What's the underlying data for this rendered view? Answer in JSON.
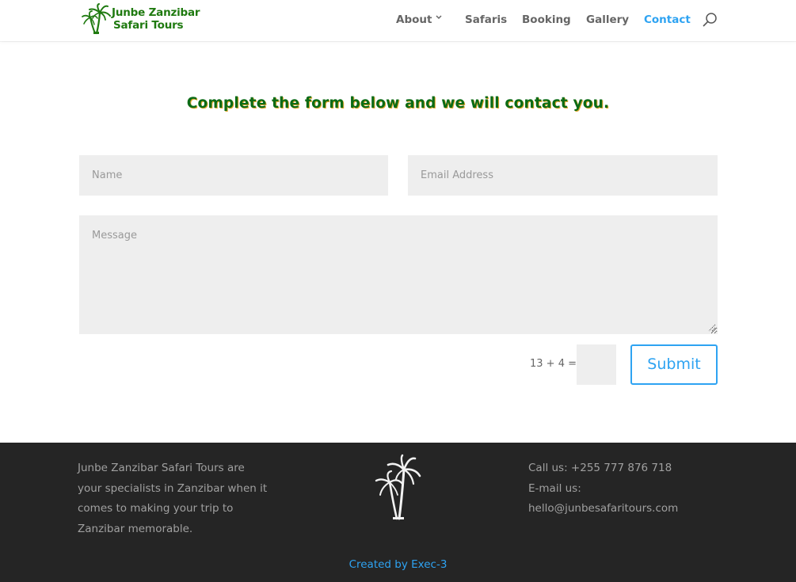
{
  "header": {
    "logo": {
      "line1": "Junbe Zanzibar",
      "line2": "Safari Tours",
      "icon": "palm-trees-icon",
      "color": "#1f7a10"
    },
    "nav": [
      {
        "label": "About",
        "has_dropdown": true,
        "dropdown_icon": "chevron-down-icon",
        "active": false
      },
      {
        "label": "Safaris",
        "active": false
      },
      {
        "label": "Booking",
        "active": false
      },
      {
        "label": "Gallery",
        "active": false
      },
      {
        "label": "Contact",
        "active": true
      }
    ],
    "search_icon": "search-icon",
    "active_color": "#2ea3f2"
  },
  "main": {
    "heading": "Complete the form below and we will contact you.",
    "heading_color": "#0b6b16",
    "form": {
      "name": {
        "placeholder": "Name",
        "value": ""
      },
      "email": {
        "placeholder": "Email Address",
        "value": ""
      },
      "message": {
        "placeholder": "Message",
        "value": ""
      },
      "captcha": {
        "label": "13 + 4 =",
        "value": ""
      },
      "submit_label": "Submit"
    }
  },
  "footer": {
    "about_text": "Junbe Zanzibar Safari Tours are your specialists in Zanzibar when it comes to making your trip to Zanzibar memorable.",
    "center_icon": "palm-trees-icon",
    "call": "Call us: +255 777 876 718",
    "email_label": "E-mail us:",
    "email": "hello@junbesafaritours.com",
    "credit": "Created by Exec-3",
    "background": "#252525",
    "link_color": "#2ea3f2"
  }
}
